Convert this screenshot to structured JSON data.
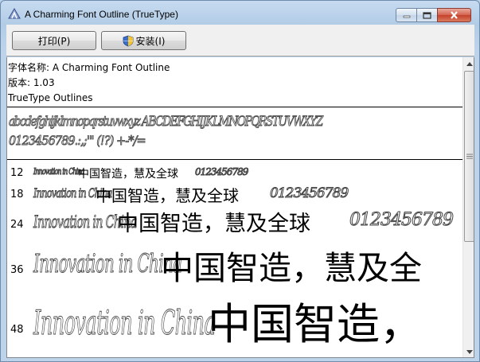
{
  "window": {
    "title": "A Charming Font Outline (TrueType)",
    "controls": {
      "minimize": "minimize",
      "maximize": "maximize",
      "close": "close"
    }
  },
  "toolbar": {
    "print_label": "打印(P)",
    "install_label": "安装(I)"
  },
  "info": {
    "font_name": "字体名称: A Charming Font Outline",
    "version": "版本: 1.03",
    "outline_type": "TrueType Outlines"
  },
  "charset_sample": {
    "line1": "abcdefghijklmnopqrstuvwxyz ABCDEFGHIJKLMNOPQRSTUVWXYZ",
    "line2": "0123456789.:,;'\" (!?) +-*/="
  },
  "size_samples": [
    {
      "size": "12",
      "latin": "Innovation in China",
      "cjk": "中国智造，慧及全球",
      "digits": "0123456789"
    },
    {
      "size": "18",
      "latin": "Innovation in China",
      "cjk": "中国智造，慧及全球",
      "digits": "0123456789"
    },
    {
      "size": "24",
      "latin": "Innovation in China",
      "cjk": "中国智造，慧及全球",
      "digits": "0123456789"
    },
    {
      "size": "36",
      "latin": "Innovation in China",
      "cjk": "中国智造，慧及全"
    },
    {
      "size": "48",
      "latin": "Innovation in China",
      "cjk": "中国智造，"
    }
  ],
  "colors": {
    "titlebar": "#bcd3ea",
    "toolbar": "#f0f0f0",
    "close_button": "#c4412a",
    "content_bg": "#ffffff"
  },
  "icons": {
    "app": "font-viewer-icon",
    "install": "uac-shield-icon"
  }
}
